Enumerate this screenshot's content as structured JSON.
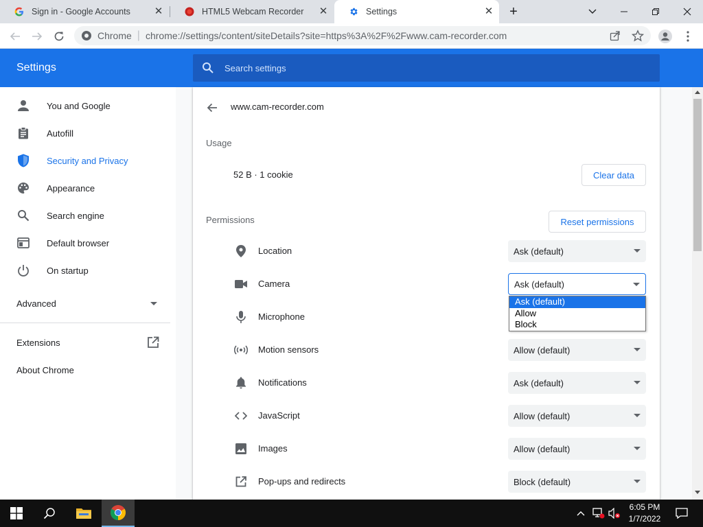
{
  "tabs": [
    {
      "title": "Sign in - Google Accounts",
      "icon": "google-g-icon"
    },
    {
      "title": "HTML5 Webcam Recorder",
      "icon": "record-icon"
    },
    {
      "title": "Settings",
      "icon": "gear-icon"
    }
  ],
  "toolbar": {
    "omnibox_chrome": "Chrome",
    "omnibox_url": "chrome://settings/content/siteDetails?site=https%3A%2F%2Fwww.cam-recorder.com"
  },
  "settings": {
    "title": "Settings",
    "search_placeholder": "Search settings"
  },
  "sidebar": {
    "items": [
      {
        "label": "You and Google",
        "icon": "person-icon"
      },
      {
        "label": "Autofill",
        "icon": "clipboard-icon"
      },
      {
        "label": "Security and Privacy",
        "icon": "shield-icon",
        "selected": true
      },
      {
        "label": "Appearance",
        "icon": "palette-icon"
      },
      {
        "label": "Search engine",
        "icon": "search-icon"
      },
      {
        "label": "Default browser",
        "icon": "browser-icon"
      },
      {
        "label": "On startup",
        "icon": "power-icon"
      }
    ],
    "advanced": "Advanced",
    "extensions": "Extensions",
    "about": "About Chrome"
  },
  "site": {
    "name": "www.cam-recorder.com",
    "usage_heading": "Usage",
    "usage_value": "52 B · 1 cookie",
    "clear_data": "Clear data",
    "permissions_heading": "Permissions",
    "reset_permissions": "Reset permissions"
  },
  "permissions": [
    {
      "label": "Location",
      "value": "Ask (default)",
      "icon": "location-pin-icon"
    },
    {
      "label": "Camera",
      "value": "Ask (default)",
      "icon": "camera-icon"
    },
    {
      "label": "Microphone",
      "value": "",
      "icon": "microphone-icon"
    },
    {
      "label": "Motion sensors",
      "value": "Allow (default)",
      "icon": "motion-sensor-icon"
    },
    {
      "label": "Notifications",
      "value": "Ask (default)",
      "icon": "bell-icon"
    },
    {
      "label": "JavaScript",
      "value": "Allow (default)",
      "icon": "code-icon"
    },
    {
      "label": "Images",
      "value": "Allow (default)",
      "icon": "image-icon"
    },
    {
      "label": "Pop-ups and redirects",
      "value": "Block (default)",
      "icon": "open-in-new-icon"
    }
  ],
  "camera_dropdown": {
    "options": [
      "Ask (default)",
      "Allow",
      "Block"
    ],
    "selected": "Ask (default)"
  },
  "taskbar": {
    "time": "6:05 PM",
    "date": "1/7/2022"
  },
  "colors": {
    "accent": "#1a73e8",
    "header": "#1a73e8",
    "taskbar": "#101010"
  }
}
